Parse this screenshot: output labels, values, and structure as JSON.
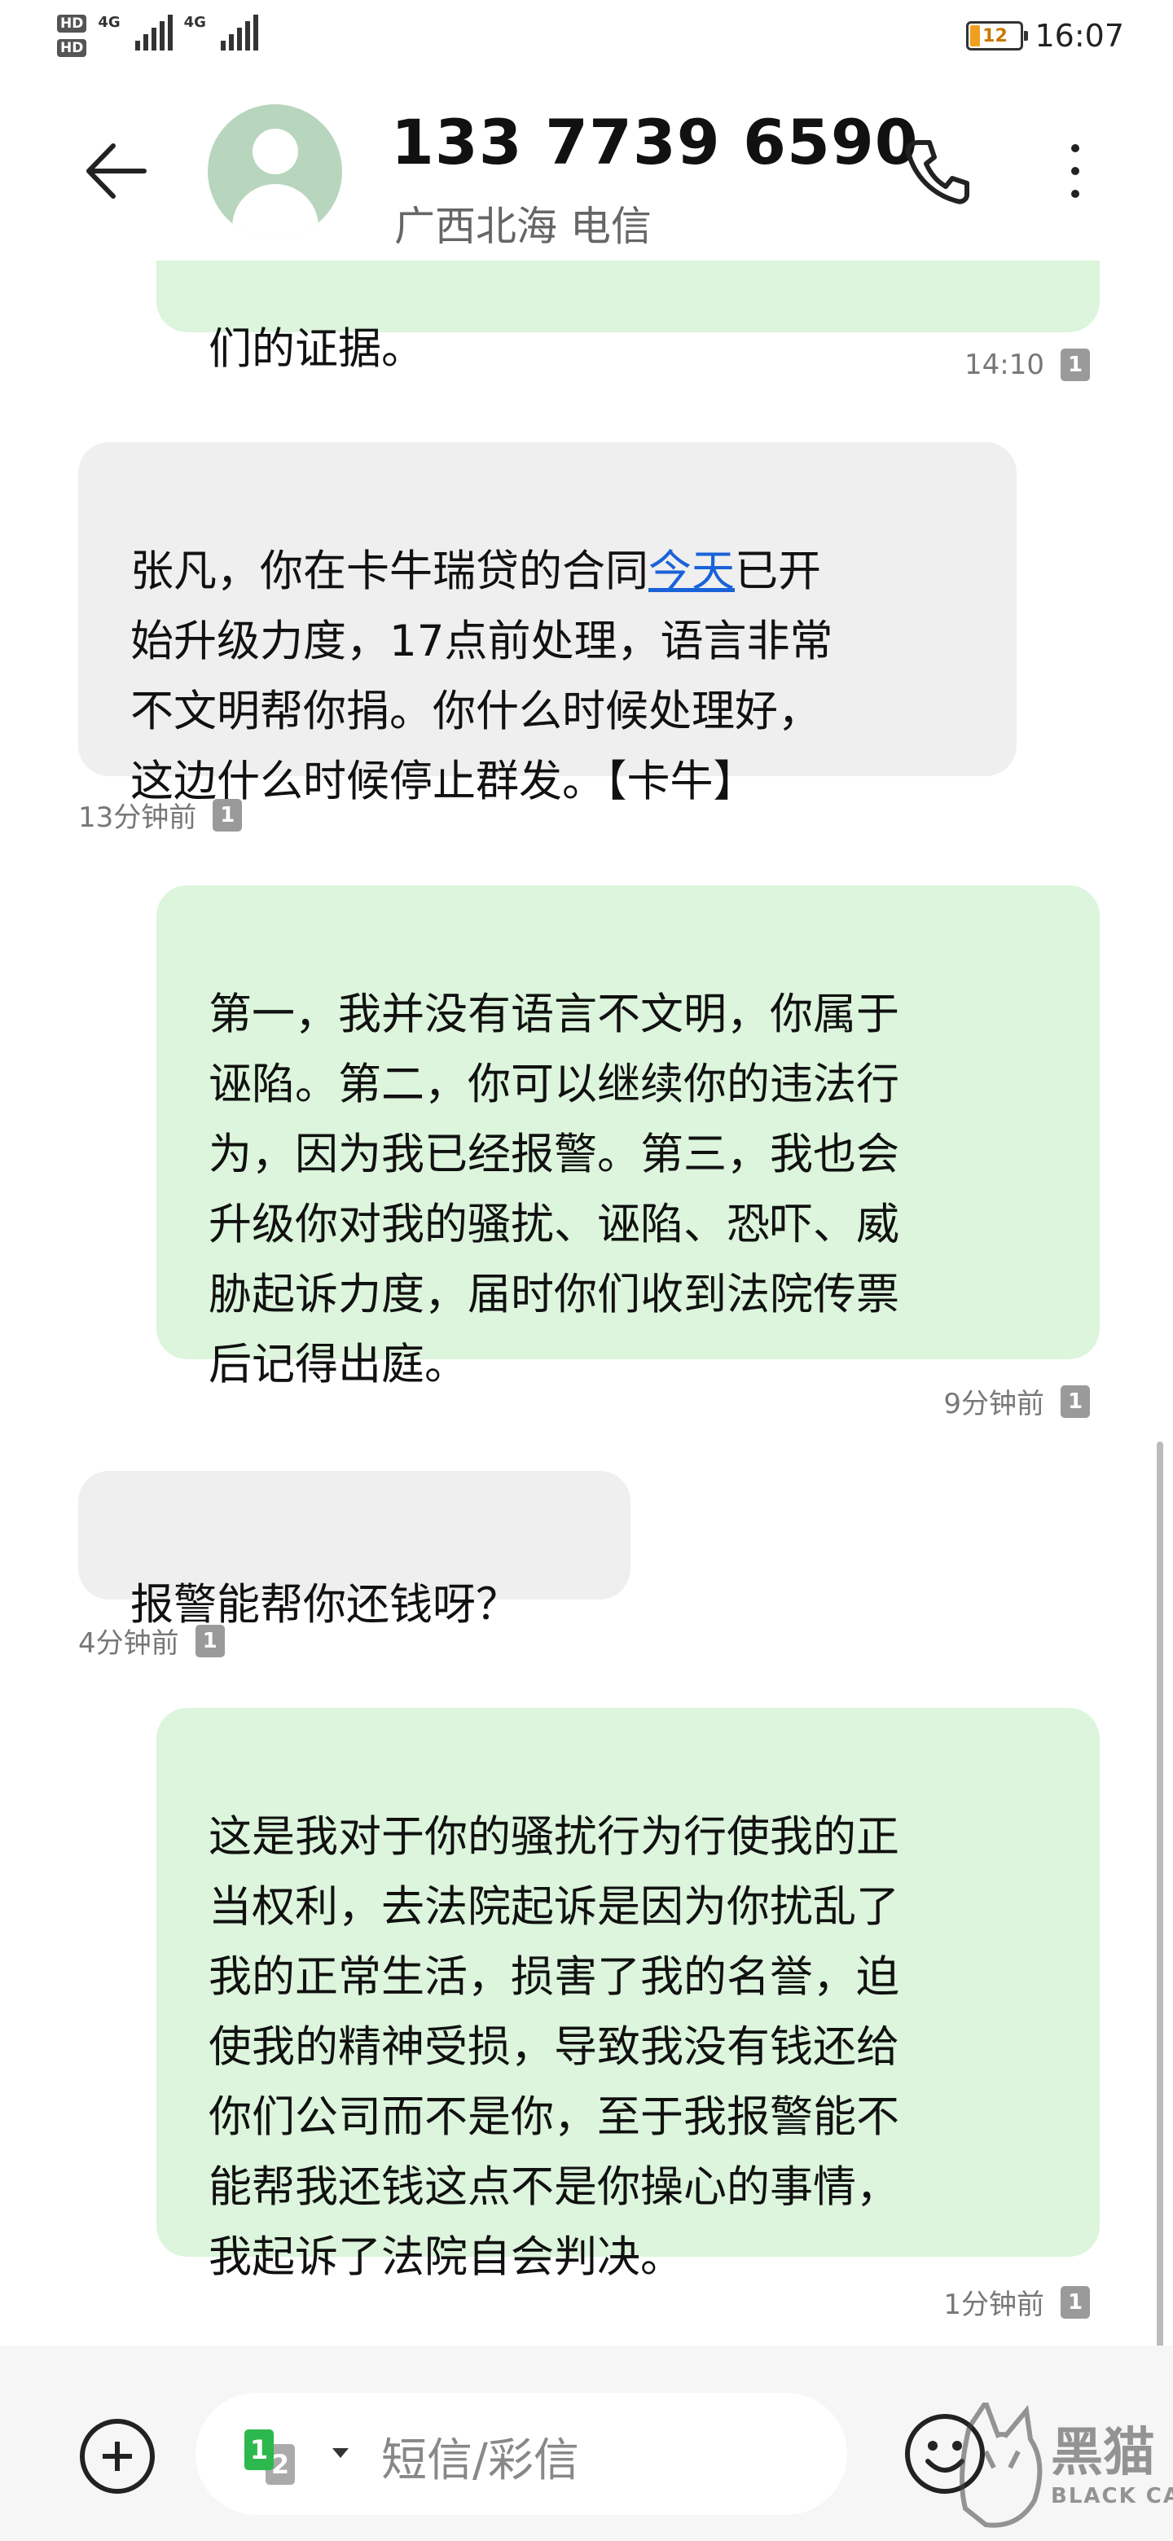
{
  "status_bar": {
    "net1_hd": "HD",
    "net1_type": "4G",
    "net2_hd": "HD",
    "net2_type": "4G",
    "battery_percent": "12",
    "time": "16:07"
  },
  "header": {
    "contact_number": "133 7739 6590",
    "contact_location": "广西北海 电信",
    "back_icon": "arrow-left-icon",
    "call_icon": "phone-icon",
    "more_icon": "more-vertical-icon"
  },
  "messages": [
    {
      "direction": "outgoing",
      "text": "们的证据。",
      "time": "14:10",
      "sim": "1"
    },
    {
      "direction": "incoming",
      "text_before_link": "张凡，你在卡牛瑞贷的合同",
      "link_text": "今天",
      "text_after_link": "已开\n始升级力度，17点前处理，语言非常\n不文明帮你捐。你什么时候处理好，\n这边什么时候停止群发。【卡牛】",
      "time": "13分钟前",
      "sim": "1"
    },
    {
      "direction": "outgoing",
      "text": "第一，我并没有语言不文明，你属于\n诬陷。第二，你可以继续你的违法行\n为，因为我已经报警。第三，我也会\n升级你对我的骚扰、诬陷、恐吓、威\n胁起诉力度，届时你们收到法院传票\n后记得出庭。",
      "time": "9分钟前",
      "sim": "1"
    },
    {
      "direction": "incoming",
      "text": "报警能帮你还钱呀？",
      "time": "4分钟前",
      "sim": "1"
    },
    {
      "direction": "outgoing",
      "text": "这是我对于你的骚扰行为行使我的正\n当权利，去法院起诉是因为你扰乱了\n我的正常生活，损害了我的名誉，迫\n使我的精神受损，导致我没有钱还给\n你们公司而不是你，至于我报警能不\n能帮我还钱这点不是你操心的事情，\n我起诉了法院自会判决。",
      "time": "1分钟前",
      "sim": "1"
    }
  ],
  "composer": {
    "sim_primary": "1",
    "sim_secondary": "2",
    "placeholder": "短信/彩信",
    "add_icon": "add-circle-icon",
    "emoji_icon": "emoji-icon"
  },
  "watermark": {
    "text": "黑猫",
    "subtext": "BLACK CAT"
  },
  "colors": {
    "incoming_bubble": "#efefef",
    "outgoing_bubble": "#dcf5dc",
    "link": "#1a62d8",
    "sim_badge": "#9a9a9a",
    "sim_green": "#2db84d",
    "avatar_bg": "#b7d6bd"
  }
}
